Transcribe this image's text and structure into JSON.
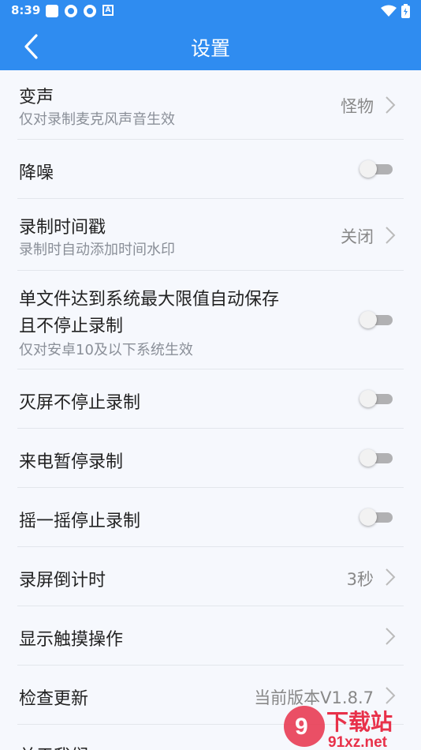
{
  "status": {
    "time": "8:39",
    "a_badge": "A"
  },
  "header": {
    "title": "设置"
  },
  "settings": [
    {
      "label": "变声",
      "sub": "仅对录制麦克风声音生效",
      "value": "怪物"
    },
    {
      "label": "降噪"
    },
    {
      "label": "录制时间戳",
      "sub": "录制时自动添加时间水印",
      "value": "关闭"
    },
    {
      "label_line1": "单文件达到系统最大限值自动保存",
      "label_line2": "且不停止录制",
      "sub": "仅对安卓10及以下系统生效"
    },
    {
      "label": "灭屏不停止录制"
    },
    {
      "label": "来电暂停录制"
    },
    {
      "label": "摇一摇停止录制"
    },
    {
      "label": "录屏倒计时",
      "value": "3秒"
    },
    {
      "label": "显示触摸操作"
    },
    {
      "label": "检查更新",
      "value": "当前版本V1.8.7"
    },
    {
      "label": "关于我们"
    }
  ],
  "watermark": {
    "text_top": "下载站",
    "text_bottom": "91xz.net"
  },
  "colors": {
    "primary": "#2f8cf0",
    "background": "#f6f8fd",
    "divider": "#e3e6ec",
    "watermark": "#e8314a"
  }
}
